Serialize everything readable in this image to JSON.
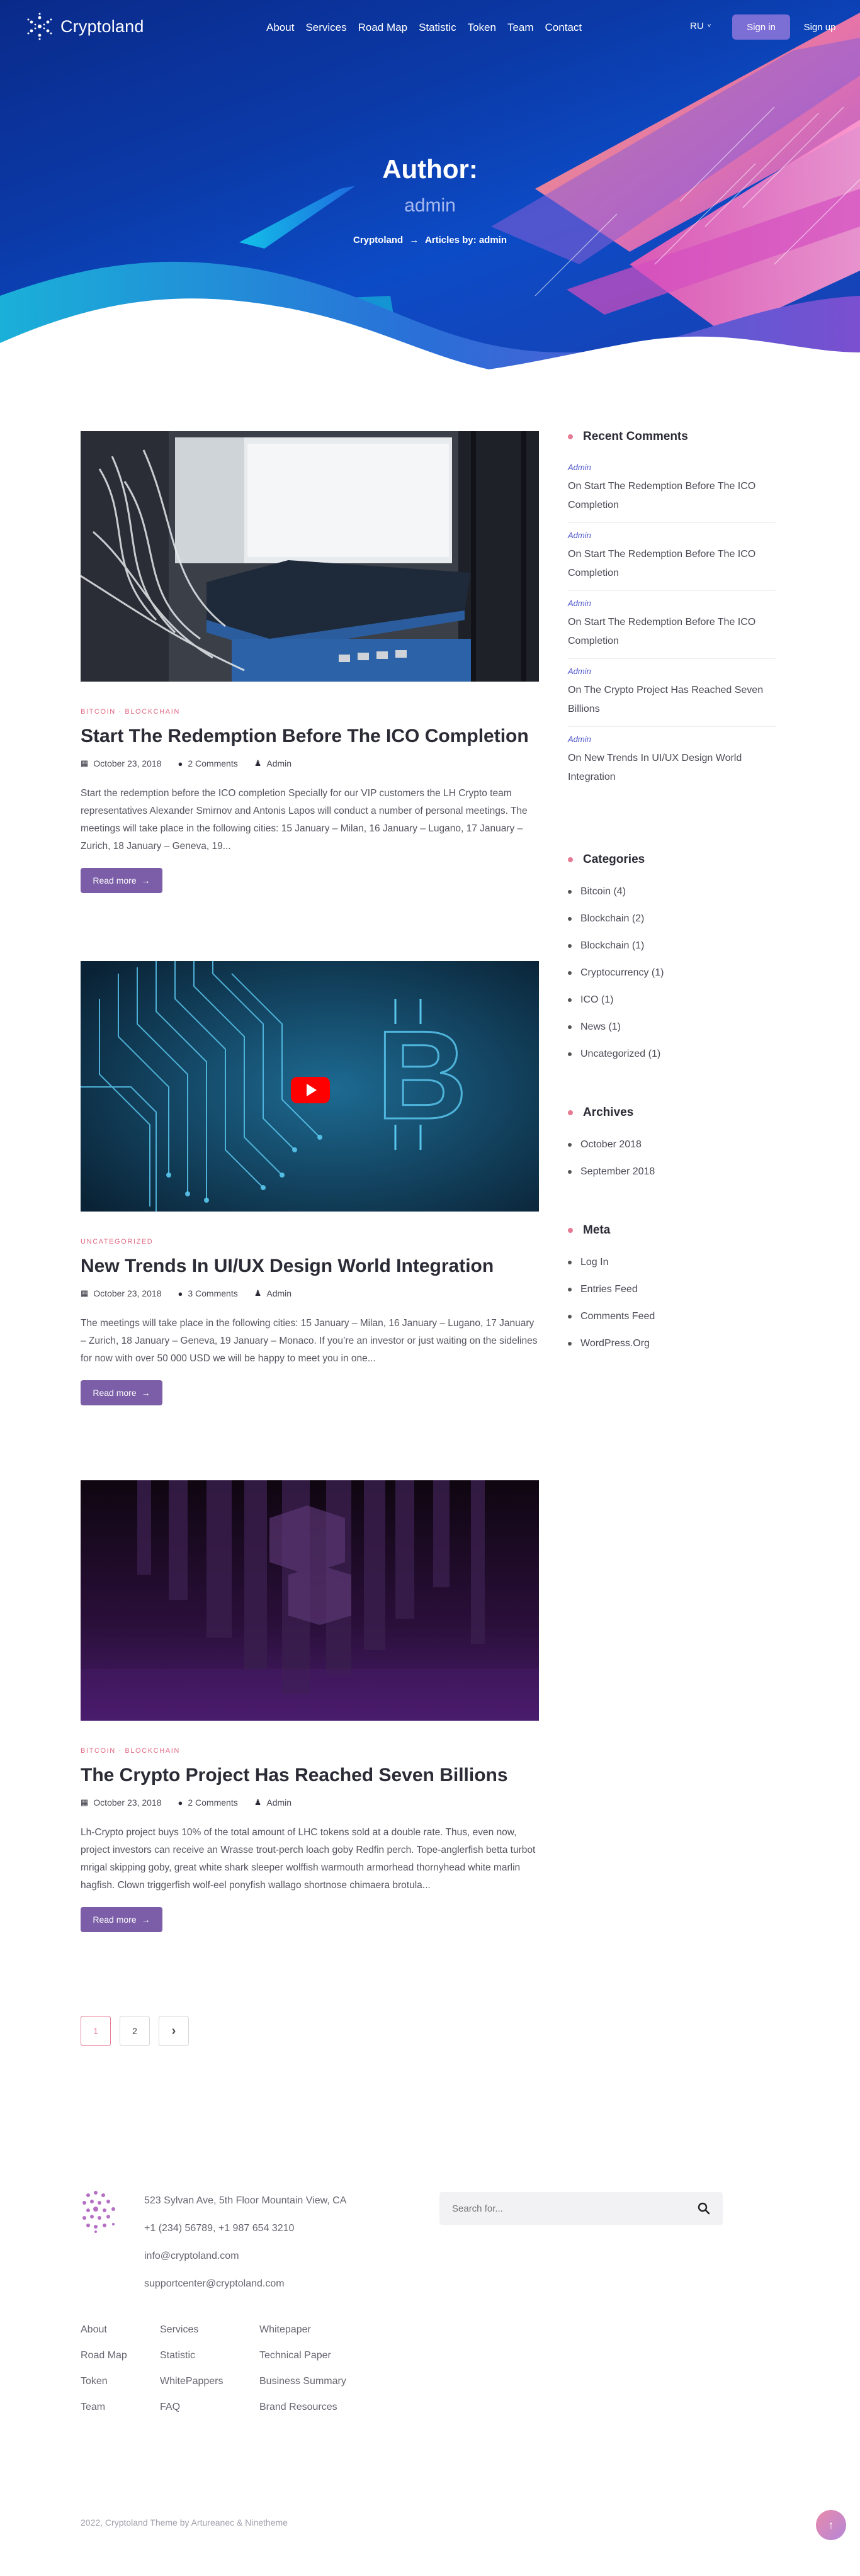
{
  "brand": {
    "name": "Cryptoland"
  },
  "nav": {
    "items": [
      "About",
      "Services",
      "Road Map",
      "Statistic",
      "Token",
      "Team",
      "Contact"
    ],
    "lang": "RU",
    "signin": "Sign in",
    "signup": "Sign up"
  },
  "hero": {
    "title": "Author:",
    "subtitle": "admin",
    "breadcrumb_home": "Cryptoland",
    "breadcrumb_sep": "→",
    "breadcrumb_current": "Articles by: admin"
  },
  "posts": [
    {
      "categories": "BITCOIN · BLOCKCHAIN",
      "title": "Start The Redemption Before The ICO Completion",
      "date": "October 23, 2018",
      "comments": "2 Comments",
      "author": "Admin",
      "excerpt": "Start the redemption before the ICO completion Specially for our VIP customers the LH Crypto team representatives Alexander Smirnov and Antonis Lapos will conduct a number of personal meetings. The meetings will take place in the following cities: 15 January – Milan, 16 January – Lugano, 17 January – Zurich, 18 January – Geneva, 19...",
      "read_more": "Read more",
      "image": "server-rack-photo"
    },
    {
      "categories": "UNCATEGORIZED",
      "title": "New Trends In UI/UX Design World Integration",
      "date": "October 23, 2018",
      "comments": "3 Comments",
      "author": "Admin",
      "excerpt": "The meetings will take place in the following cities: 15 January – Milan, 16 January – Lugano, 17 January – Zurich, 18 January – Geneva, 19 January – Monaco. If you’re an investor or just waiting on the sidelines for now with over 50 000 USD we will be happy to meet you in one...",
      "read_more": "Read more",
      "image": "bitcoin-circuit-video"
    },
    {
      "categories": "BITCOIN · BLOCKCHAIN",
      "title": "The Crypto Project Has Reached Seven Billions",
      "date": "October 23, 2018",
      "comments": "2 Comments",
      "author": "Admin",
      "excerpt": "Lh-Crypto project buys 10% of the total amount of LHC tokens sold at a double rate. Thus, even now, project investors can receive an Wrasse trout-perch loach goby Redfin perch. Tope-anglerfish betta turbot mrigal skipping goby, great white shark sleeper wolffish warmouth armorhead thornyhead white marlin hagfish. Clown triggerfish wolf-eel ponyfish wallago shortnose chimaera brotula...",
      "read_more": "Read more",
      "image": "purple-blocks-render"
    }
  ],
  "pagination": {
    "pages": [
      "1",
      "2"
    ],
    "next": "›",
    "current": "1"
  },
  "sidebar": {
    "recent_comments": {
      "title": "Recent Comments",
      "items": [
        {
          "author": "Admin",
          "on": "On",
          "post": "Start The Redemption Before The ICO Completion"
        },
        {
          "author": "Admin",
          "on": "On",
          "post": "Start The Redemption Before The ICO Completion"
        },
        {
          "author": "Admin",
          "on": "On",
          "post": "Start The Redemption Before The ICO Completion"
        },
        {
          "author": "Admin",
          "on": "On",
          "post": "The Crypto Project Has Reached Seven Billions"
        },
        {
          "author": "Admin",
          "on": "On",
          "post": "New Trends In UI/UX Design World Integration"
        }
      ]
    },
    "categories": {
      "title": "Categories",
      "items": [
        "Bitcoin (4)",
        "Blockchain (2)",
        "Blockchain (1)",
        "Cryptocurrency (1)",
        "ICO (1)",
        "News (1)",
        "Uncategorized (1)"
      ]
    },
    "archives": {
      "title": "Archives",
      "items": [
        "October 2018",
        "September 2018"
      ]
    },
    "meta": {
      "title": "Meta",
      "items": [
        "Log In",
        "Entries Feed",
        "Comments Feed",
        "WordPress.Org"
      ]
    }
  },
  "footer": {
    "address": "523 Sylvan Ave, 5th Floor Mountain View, CA",
    "phones": "+1 (234) 56789,  +1 987 654 3210",
    "email": "info@cryptoland.com",
    "support": "supportcenter@cryptoland.com",
    "search_placeholder": "Search for...",
    "col1": [
      "About",
      "Road Map",
      "Token",
      "Team"
    ],
    "col2": [
      "Services",
      "Statistic",
      "WhitePappers",
      "FAQ"
    ],
    "col3": [
      "Whitepaper",
      "Technical Paper",
      "Business Summary",
      "Brand Resources"
    ],
    "copyright": "2022, Cryptoland Theme by Artureanec & Ninetheme"
  },
  "colors": {
    "accent": "#7b5ea7",
    "pink": "#e77b94",
    "hero_blue": "#0b3aa8"
  }
}
